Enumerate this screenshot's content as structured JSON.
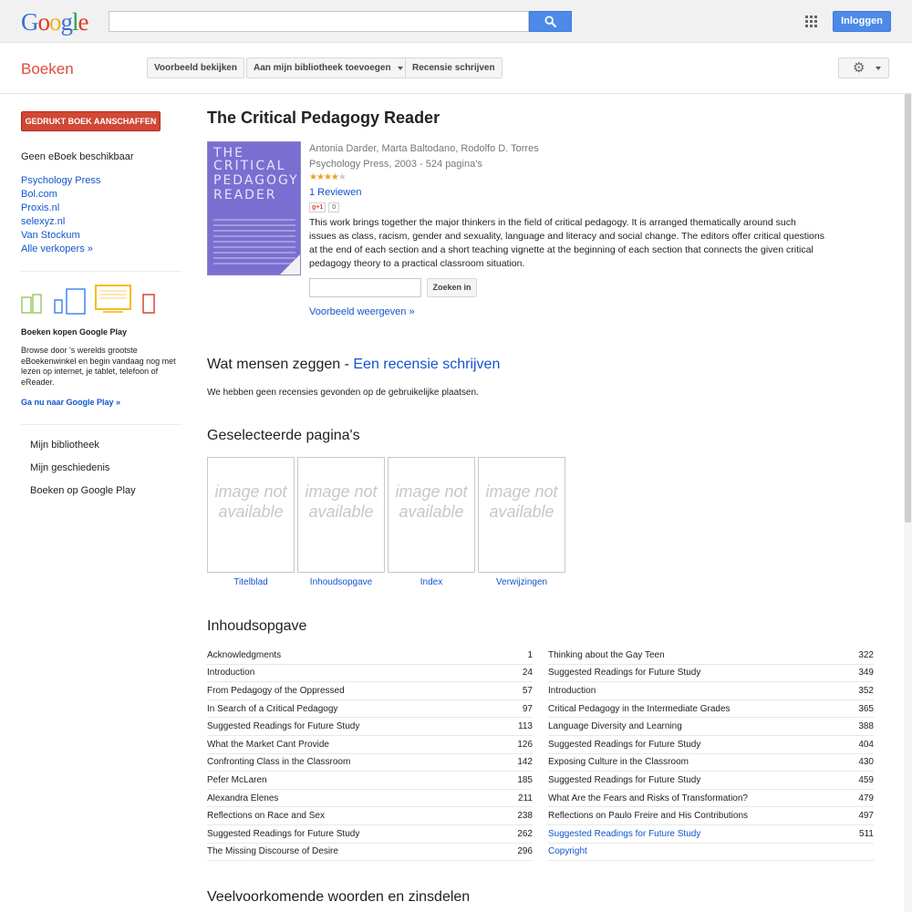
{
  "header": {
    "logo_letters": [
      {
        "ch": "G",
        "color": "#3b6ed8"
      },
      {
        "ch": "o",
        "color": "#dd3a2b"
      },
      {
        "ch": "o",
        "color": "#f1b21b"
      },
      {
        "ch": "g",
        "color": "#3b6ed8"
      },
      {
        "ch": "l",
        "color": "#2aa147"
      },
      {
        "ch": "e",
        "color": "#dd3a2b"
      }
    ],
    "search_value": "",
    "login_label": "Inloggen"
  },
  "toolbar": {
    "section_title": "Boeken",
    "preview_label": "Voorbeeld bekijken",
    "library_label": "Aan mijn bibliotheek toevoegen",
    "review_label": "Recensie schrijven"
  },
  "sidebar": {
    "buy_label": "GEDRUKT BOEK AANSCHAFFEN",
    "no_ebook": "Geen eBoek beschikbaar",
    "sellers": [
      "Psychology Press",
      "Bol.com",
      "Proxis.nl",
      "selexyz.nl",
      "Van Stockum",
      "Alle verkopers »"
    ],
    "play_title": "Boeken kopen Google Play",
    "play_desc": "Browse door 's werelds grootste eBoekenwinkel en begin vandaag nog met lezen op internet, je tablet, telefoon of eReader.",
    "play_link": "Ga nu naar Google Play »",
    "nav": [
      "Mijn bibliotheek",
      "Mijn geschiedenis",
      "Boeken op Google Play"
    ]
  },
  "book": {
    "title": "The Critical Pedagogy Reader",
    "cover_lines": [
      "THE",
      "CRITICAL",
      "PEDAGOGY",
      "READER"
    ],
    "authors": "Antonia Darder, Marta Baltodano, Rodolfo D. Torres",
    "publisher": "Psychology Press, 2003 - 524 pagina's",
    "rating": 4,
    "rating_max": 5,
    "reviews_link": "1 Reviewen",
    "gplus_label": "g+1",
    "gplus_count": "0",
    "description": "This work brings together the major thinkers in the field of critical pedagogy. It is arranged thematically around such issues as class, racism, gender and sexuality, language and literacy and social change. The editors offer critical questions at the end of each section and a short teaching vignette at the beginning of each section that connects the given critical pedagogy theory to a practical classroom situation.",
    "search_inside_value": "",
    "search_inside_label": "Zoeken in",
    "preview_link": "Voorbeeld weergeven »"
  },
  "reviews": {
    "heading": "Wat mensen zeggen - ",
    "heading_link": "Een recensie schrijven",
    "empty": "We hebben geen recensies gevonden op de gebruikelijke plaatsen."
  },
  "selected": {
    "heading": "Geselecteerde pagina's",
    "unavailable_text": "image not available",
    "pages": [
      "Titelblad",
      "Inhoudsopgave",
      "Index",
      "Verwijzingen"
    ]
  },
  "toc": {
    "heading": "Inhoudsopgave",
    "left": [
      {
        "title": "Acknowledgments",
        "page": "1"
      },
      {
        "title": "Introduction",
        "page": "24"
      },
      {
        "title": "From Pedagogy of the Oppressed",
        "page": "57"
      },
      {
        "title": "In Search of a Critical Pedagogy",
        "page": "97"
      },
      {
        "title": "Suggested Readings for Future Study",
        "page": "113"
      },
      {
        "title": "What the Market Cant Provide",
        "page": "126"
      },
      {
        "title": "Confronting Class in the Classroom",
        "page": "142"
      },
      {
        "title": "Pefer McLaren",
        "page": "185"
      },
      {
        "title": "Alexandra Elenes",
        "page": "211"
      },
      {
        "title": "Reflections on Race and Sex",
        "page": "238"
      },
      {
        "title": "Suggested Readings for Future Study",
        "page": "262"
      },
      {
        "title": "The Missing Discourse of Desire",
        "page": "296"
      }
    ],
    "right": [
      {
        "title": "Thinking about the Gay Teen",
        "page": "322"
      },
      {
        "title": "Suggested Readings for Future Study",
        "page": "349"
      },
      {
        "title": "Introduction",
        "page": "352"
      },
      {
        "title": "Critical Pedagogy in the Intermediate Grades",
        "page": "365"
      },
      {
        "title": "Language Diversity and Learning",
        "page": "388"
      },
      {
        "title": "Suggested Readings for Future Study",
        "page": "404"
      },
      {
        "title": "Exposing Culture in the Classroom",
        "page": "430"
      },
      {
        "title": "Suggested Readings for Future Study",
        "page": "459"
      },
      {
        "title": "What Are the Fears and Risks of Transformation?",
        "page": "479"
      },
      {
        "title": "Reflections on Paulo Freire and His Contributions",
        "page": "497"
      },
      {
        "title": "Suggested Readings for Future Study",
        "page": "511",
        "link": true
      },
      {
        "title": "Copyright",
        "page": "",
        "link": true
      }
    ]
  },
  "words": {
    "heading": "Veelvoorkomende woorden en zinsdelen"
  },
  "colors": {
    "accent_blue": "#4d8ae8",
    "link": "#1155cc",
    "brand_red": "#dd4b39",
    "buy_red": "#d14836",
    "star": "#e9a11f"
  }
}
